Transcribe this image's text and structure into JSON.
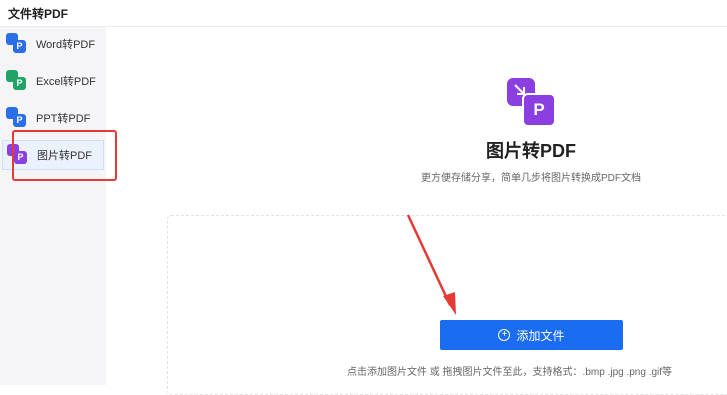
{
  "app": {
    "title": "文件转PDF"
  },
  "colors": {
    "primary": "#1a6cf0",
    "annotation_red": "#e53935",
    "word": "#2b6fe8",
    "excel": "#21a365",
    "ppt": "#2b6fe8",
    "image": "#8b3fe0"
  },
  "sidebar": {
    "items": [
      {
        "label": "Word转PDF",
        "icon": "word-to-pdf-icon",
        "badge": "P",
        "active": false
      },
      {
        "label": "Excel转PDF",
        "icon": "excel-to-pdf-icon",
        "badge": "P",
        "active": false
      },
      {
        "label": "PPT转PDF",
        "icon": "ppt-to-pdf-icon",
        "badge": "P",
        "active": false
      },
      {
        "label": "图片转PDF",
        "icon": "image-to-pdf-icon",
        "badge": "P",
        "active": true
      }
    ]
  },
  "main": {
    "icon": "image-to-pdf-icon",
    "icon_badge": "P",
    "title": "图片转PDF",
    "subtitle": "更方便存储分享，简单几步将图片转换成PDF文档",
    "add_button": {
      "icon": "plus-circle-icon",
      "label": "添加文件"
    },
    "hint": "点击添加图片文件 或 拖拽图片文件至此，支持格式：.bmp .jpg .png .gif等"
  }
}
